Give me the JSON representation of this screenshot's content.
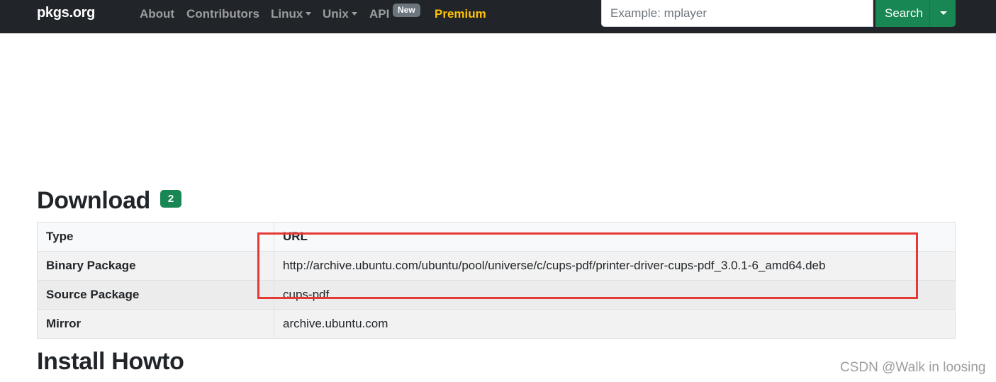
{
  "navbar": {
    "brand": "pkgs.org",
    "links": [
      {
        "label": "About",
        "dropdown": false
      },
      {
        "label": "Contributors",
        "dropdown": false
      },
      {
        "label": "Linux",
        "dropdown": true
      },
      {
        "label": "Unix",
        "dropdown": true
      },
      {
        "label": "API",
        "dropdown": false,
        "badge": "New"
      },
      {
        "label": "Premium",
        "dropdown": false
      }
    ],
    "search": {
      "placeholder": "Example: mplayer",
      "value": "",
      "button_label": "Search"
    },
    "colors": {
      "background": "#212529",
      "premium": "#ffc107",
      "search_button": "#198754"
    }
  },
  "download": {
    "title": "Download",
    "count_badge": "2",
    "table": {
      "headers": [
        "Type",
        "URL"
      ],
      "rows": [
        {
          "type": "Binary Package",
          "value": "http://archive.ubuntu.com/ubuntu/pool/universe/c/cups-pdf/printer-driver-cups-pdf_3.0.1-6_amd64.deb"
        },
        {
          "type": "Source Package",
          "value": "cups-pdf"
        },
        {
          "type": "Mirror",
          "value": "archive.ubuntu.com"
        }
      ]
    },
    "highlight_color": "#e53935"
  },
  "install": {
    "title": "Install Howto"
  },
  "watermark": "CSDN @Walk in loosing"
}
